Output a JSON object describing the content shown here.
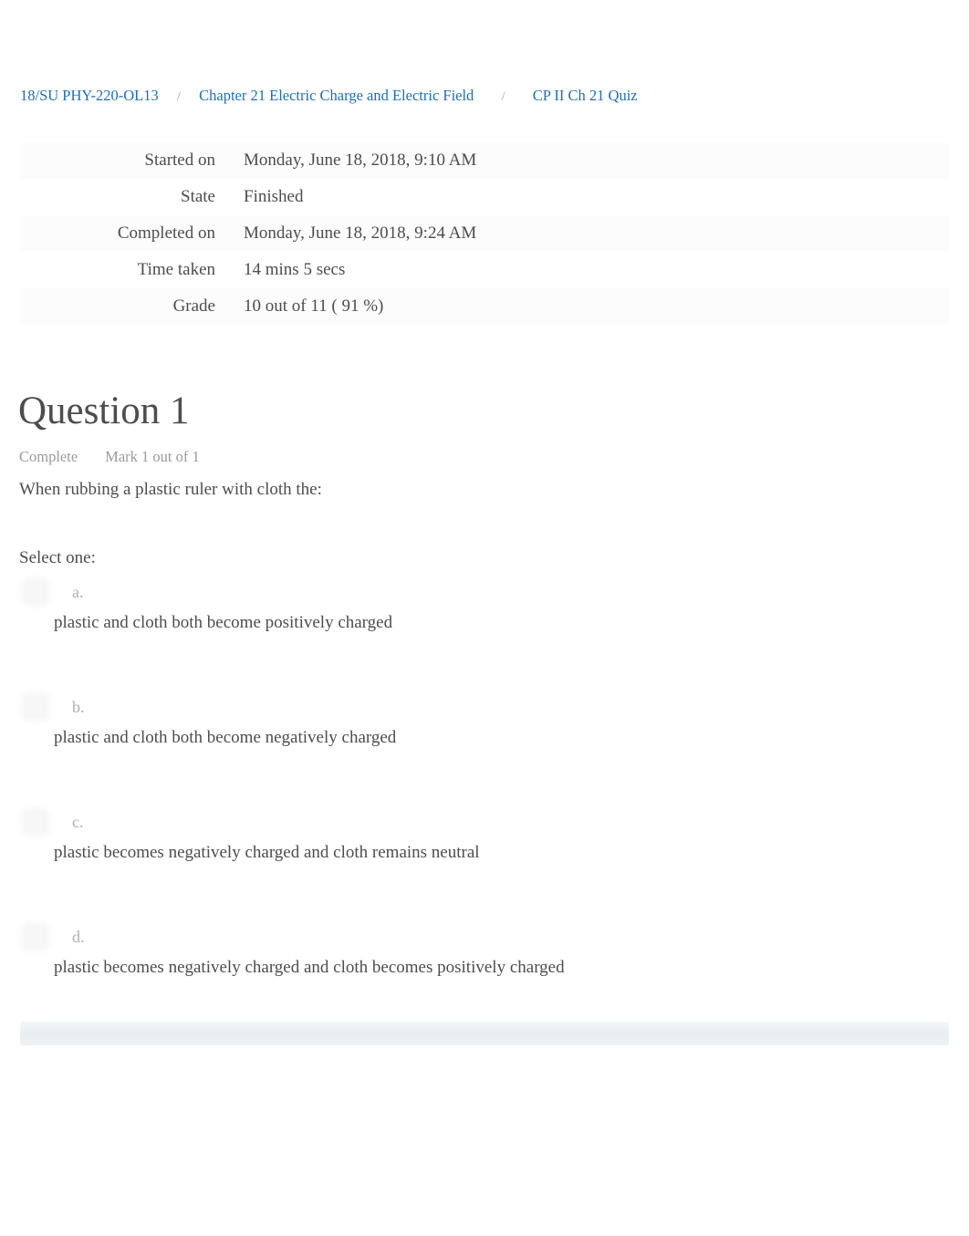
{
  "breadcrumb": {
    "items": [
      {
        "label": "18/SU PHY-220-OL13"
      },
      {
        "label": "Chapter 21 Electric Charge and Electric Field"
      },
      {
        "label": "CP II Ch 21 Quiz"
      }
    ],
    "separator": "/",
    "link_color": "#1a6fbf"
  },
  "summary": {
    "rows": [
      {
        "label": "Started on",
        "value": "Monday, June 18, 2018, 9:10 AM"
      },
      {
        "label": "State",
        "value": "Finished"
      },
      {
        "label": "Completed on",
        "value": "Monday, June 18, 2018, 9:24 AM"
      },
      {
        "label": "Time taken",
        "value": "14 mins 5 secs"
      },
      {
        "label": "Grade",
        "value": "10  out of 11 (  91 %)"
      }
    ]
  },
  "question": {
    "title": "Question 1",
    "state": "Complete",
    "mark": "Mark 1 out of 1",
    "text": "When rubbing a plastic ruler with cloth the:",
    "select_prompt": "Select one:",
    "options": [
      {
        "letter": "a.",
        "text": "plastic and cloth both become positively charged"
      },
      {
        "letter": "b.",
        "text": "plastic and cloth both become negatively charged"
      },
      {
        "letter": "c.",
        "text": "plastic becomes negatively charged and cloth remains neutral"
      },
      {
        "letter": "d.",
        "text": "plastic becomes negatively charged and cloth becomes positively charged"
      }
    ]
  },
  "footer": {
    "bar_color": "#e6eef0"
  }
}
